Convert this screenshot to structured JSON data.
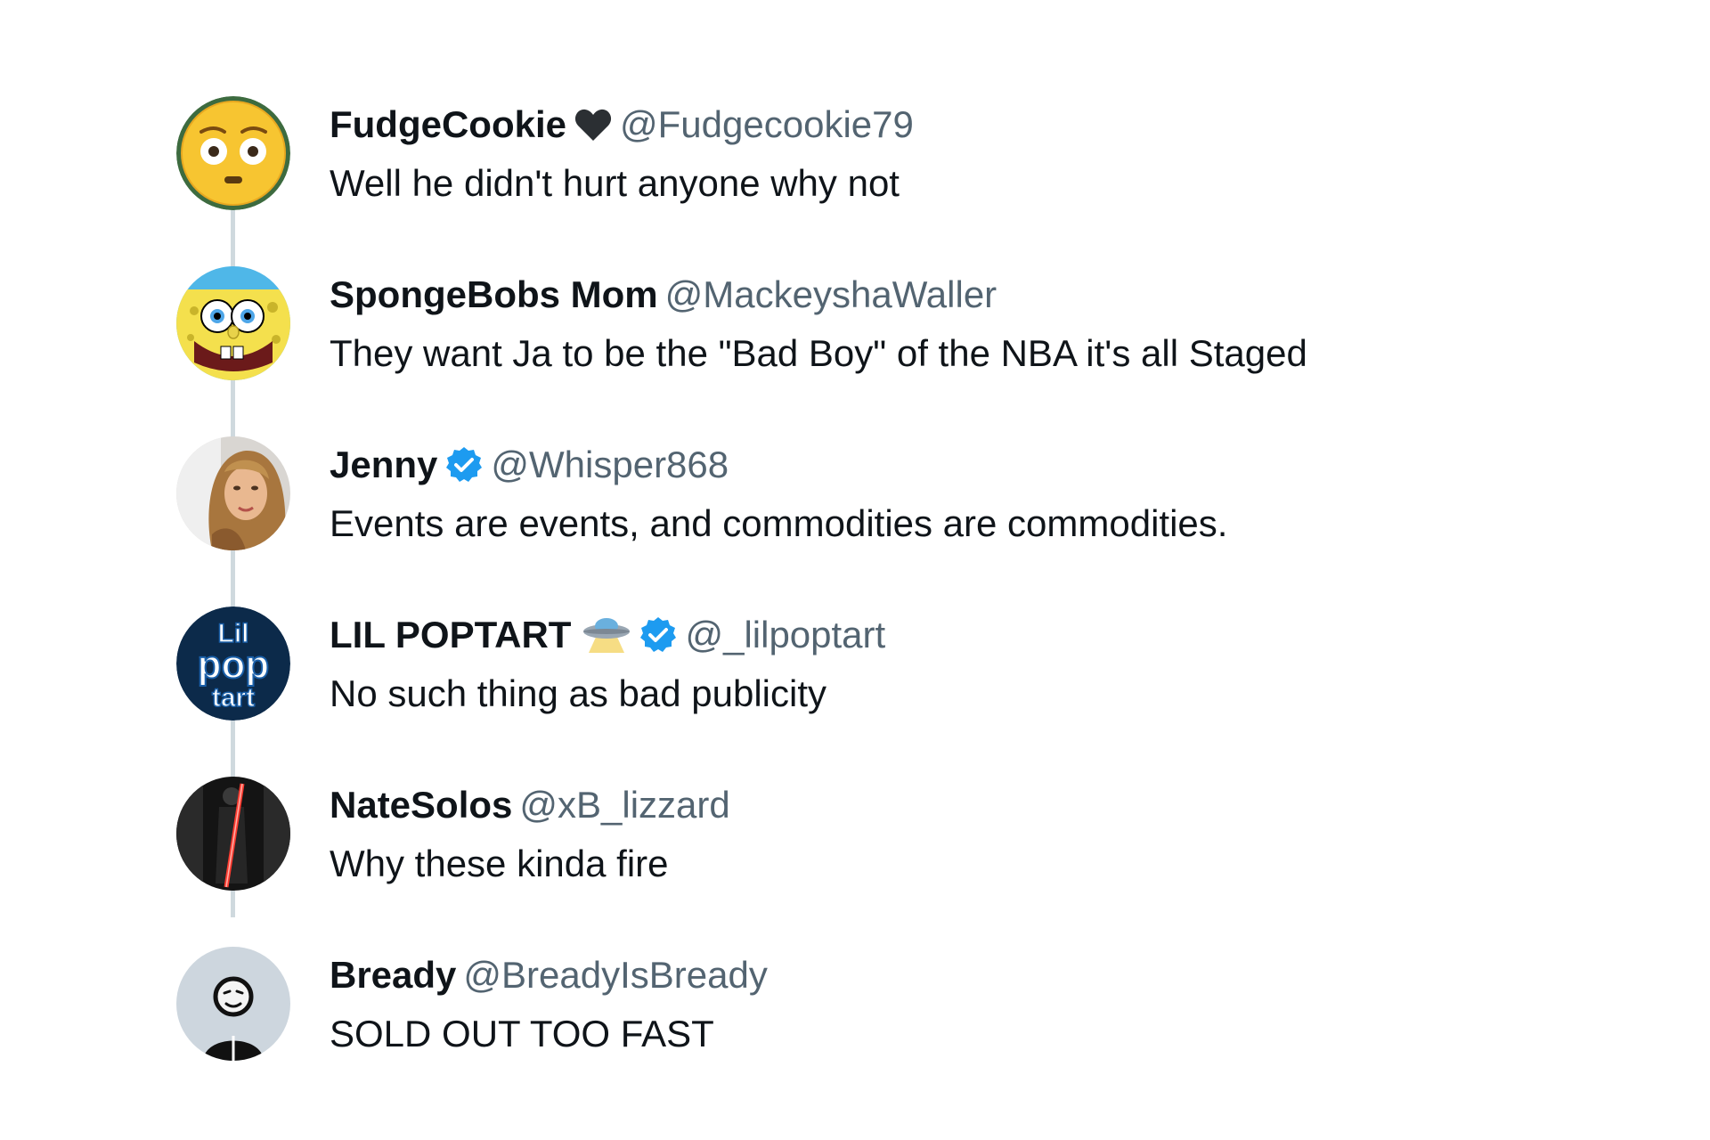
{
  "replies": [
    {
      "display_name": "FudgeCookie",
      "handle": "@Fudgecookie79",
      "text": "Well he didn't hurt anyone why not",
      "name_icon": "black-heart-icon",
      "verified": false,
      "avatar": "flushed-face-emoji"
    },
    {
      "display_name": "SpongeBobs Mom",
      "handle": "@MackeyshaWaller",
      "text": "They want Ja to be the \"Bad Boy\" of the NBA it's all Staged",
      "verified": false,
      "avatar": "spongebob-cartoon"
    },
    {
      "display_name": "Jenny",
      "handle": "@Whisper868",
      "text": "Events are events, and commodities are commodities.",
      "verified": true,
      "avatar": "woman-photo"
    },
    {
      "display_name": "LIL POPTART",
      "handle": "@_lilpoptart",
      "text": "No such thing as bad publicity",
      "name_icon": "ufo-icon",
      "verified": true,
      "avatar": "lil-pop-tart-logo",
      "avatar_text": [
        "Lil",
        "pop",
        "tart"
      ]
    },
    {
      "display_name": "NateSolos",
      "handle": "@xB_lizzard",
      "text": "Why these kinda fire",
      "verified": false,
      "avatar": "dark-figure-red-saber"
    },
    {
      "display_name": "Bready",
      "handle": "@BreadyIsBready",
      "text": "SOLD OUT TOO FAST",
      "verified": false,
      "avatar": "cartoon-person-sketch"
    }
  ],
  "colors": {
    "name": "#0f1419",
    "handle": "#536471",
    "verified": "#1d9bf0",
    "thread_line": "#cfd9de"
  }
}
